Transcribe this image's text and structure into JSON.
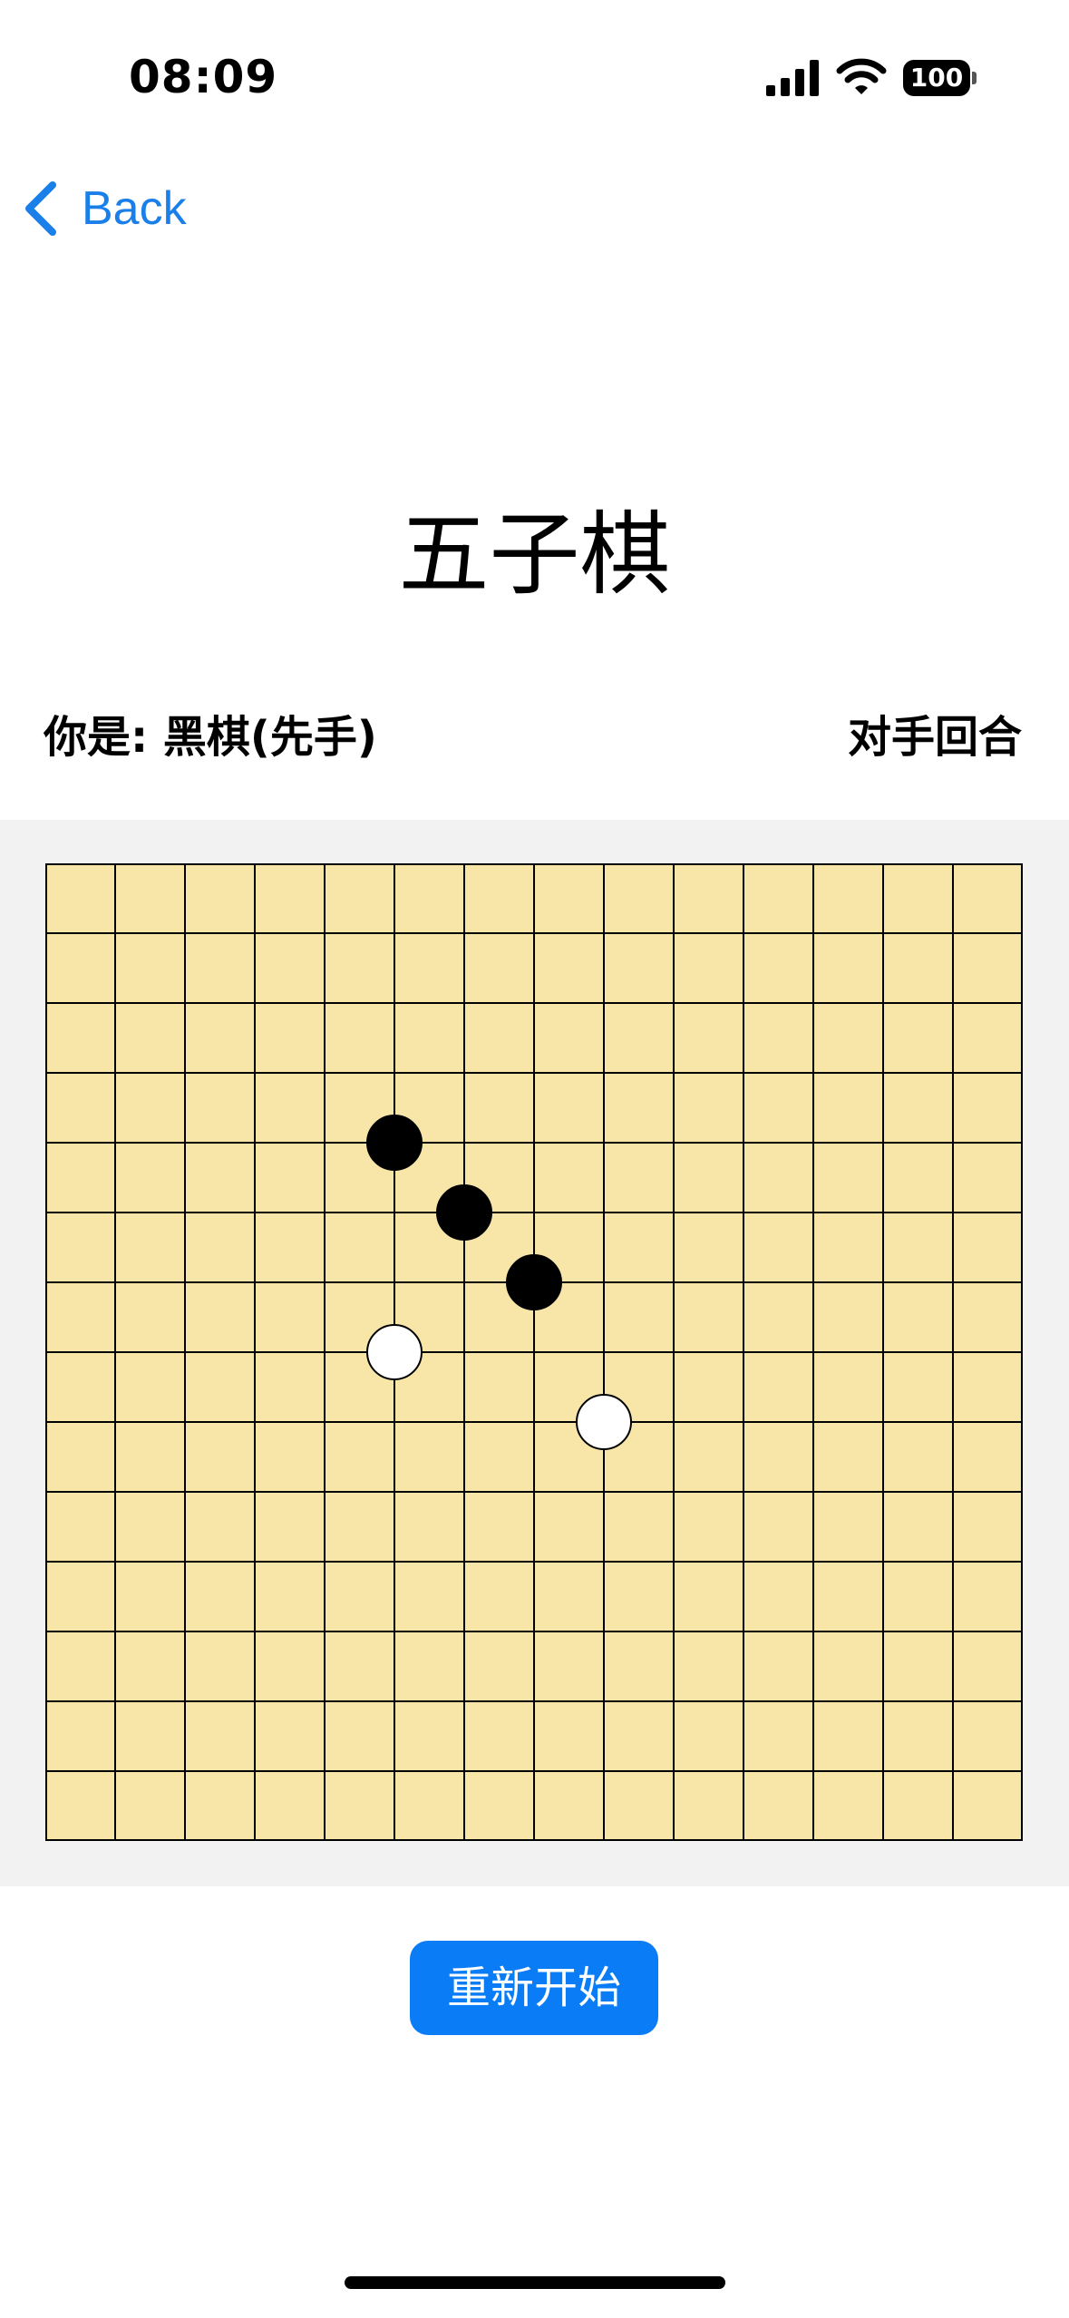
{
  "status_bar": {
    "time": "08:09",
    "battery": "100",
    "icons": [
      "signal-icon",
      "wifi-icon",
      "battery-icon"
    ]
  },
  "nav": {
    "back_label": "Back",
    "back_icon": "chevron-left-icon",
    "accent_color": "#1a7fe8"
  },
  "title": "五子棋",
  "player_info": "你是: 黑棋(先手)",
  "turn_status": "对手回合",
  "board": {
    "grid_lines": 15,
    "board_color": "#f7e6a8",
    "line_color": "#000000",
    "stones": [
      {
        "color": "black",
        "row": 4,
        "col": 5
      },
      {
        "color": "black",
        "row": 5,
        "col": 6
      },
      {
        "color": "black",
        "row": 6,
        "col": 7
      },
      {
        "color": "white",
        "row": 7,
        "col": 5
      },
      {
        "color": "white",
        "row": 8,
        "col": 8
      }
    ]
  },
  "restart_label": "重新开始",
  "restart_color": "#0a7cf5"
}
